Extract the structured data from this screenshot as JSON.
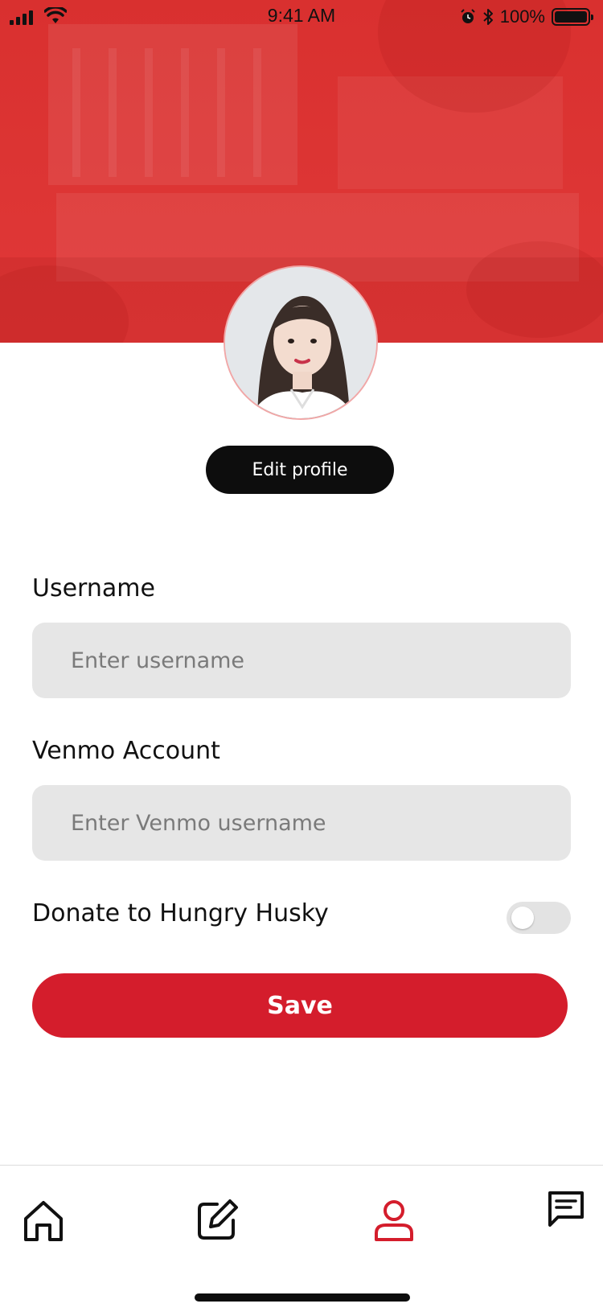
{
  "status_bar": {
    "time": "9:41 AM",
    "battery_percent": "100%",
    "icons": [
      "signal-icon",
      "wifi-icon",
      "alarm-icon",
      "bluetooth-icon",
      "battery-icon"
    ]
  },
  "profile": {
    "edit_button_label": "Edit profile",
    "avatar_alt": "avatar"
  },
  "form": {
    "username_label": "Username",
    "username_placeholder": "Enter username",
    "venmo_label": "Venmo Account",
    "venmo_placeholder": "Enter Venmo username",
    "donate_label": "Donate to Hungry Husky",
    "donate_enabled": false,
    "save_label": "Save"
  },
  "tab_bar": {
    "active": "profile",
    "tabs": [
      {
        "id": "home",
        "icon": "home-icon"
      },
      {
        "id": "edit",
        "icon": "edit-icon"
      },
      {
        "id": "profile",
        "icon": "user-icon"
      },
      {
        "id": "messages",
        "icon": "message-icon"
      }
    ]
  },
  "colors": {
    "brand_red": "#d41d2c",
    "banner_red": "#dd3534",
    "field_bg": "#e6e6e6",
    "dark": "#0d0d0d"
  }
}
